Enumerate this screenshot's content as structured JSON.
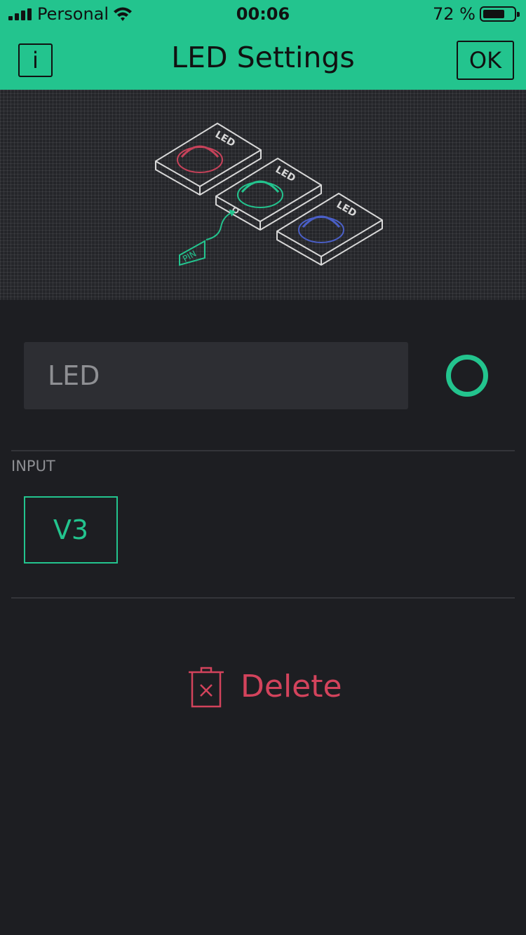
{
  "status_bar": {
    "carrier": "Personal",
    "time": "00:06",
    "battery_percent": "72 %",
    "battery_level": 0.72,
    "icons": [
      "signal-icon",
      "wifi-icon",
      "battery-icon"
    ]
  },
  "nav": {
    "title": "LED Settings",
    "info_label": "i",
    "ok_label": "OK"
  },
  "illustration": {
    "led_label": "LED",
    "pin_label": "PIN",
    "led_colors": [
      "#c7425a",
      "#23c48e",
      "#4a5fc7"
    ]
  },
  "name_field": {
    "value": "LED"
  },
  "color": {
    "accent": "#23c48e",
    "danger": "#d3435c"
  },
  "input_section": {
    "label": "INPUT",
    "pin_value": "V3"
  },
  "delete": {
    "label": "Delete",
    "icon": "trash-icon"
  }
}
